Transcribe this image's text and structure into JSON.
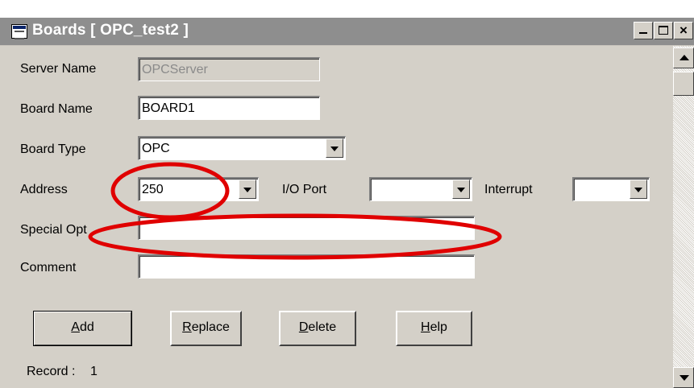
{
  "window": {
    "title": "Boards [ OPC_test2 ]",
    "minimize": "_",
    "maximize": "□",
    "close": "×"
  },
  "form": {
    "server_name": {
      "label": "Server Name",
      "value": "OPCServer"
    },
    "board_name": {
      "label": "Board Name",
      "value": "BOARD1"
    },
    "board_type": {
      "label": "Board Type",
      "value": "OPC"
    },
    "address": {
      "label": "Address",
      "value": "250"
    },
    "io_port": {
      "label": "I/O Port",
      "value": ""
    },
    "interrupt": {
      "label": "Interrupt",
      "value": ""
    },
    "special_opt": {
      "label": "Special Opt",
      "value": ""
    },
    "comment": {
      "label": "Comment",
      "value": ""
    }
  },
  "buttons": {
    "add": {
      "key": "A",
      "rest": "dd"
    },
    "replace": {
      "key": "R",
      "rest": "eplace"
    },
    "delete": {
      "key": "D",
      "rest": "elete"
    },
    "help": {
      "key": "H",
      "rest": "elp"
    }
  },
  "status": {
    "record_label": "Record :",
    "record_value": "1"
  },
  "colors": {
    "annotation": "#e00000",
    "title_bar": "#8e8e8e",
    "face": "#d4d0c8"
  }
}
